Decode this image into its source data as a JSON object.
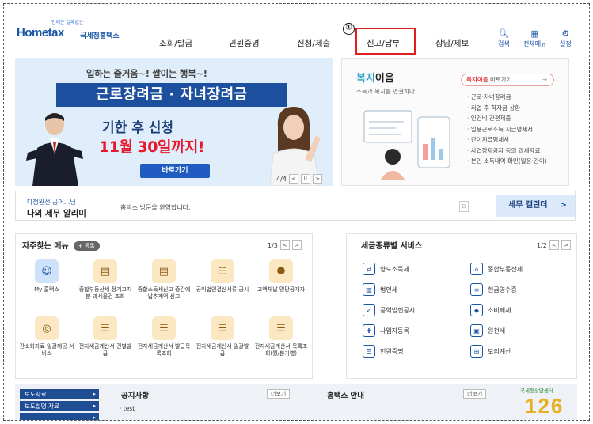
{
  "header": {
    "logo_tagline": "언제든 실패없는",
    "logo_main": "Hometax",
    "logo_sub": "국세청홈택스",
    "nav": [
      "조회/발급",
      "민원증명",
      "신청/제출",
      "신고/납부",
      "상담/제보"
    ],
    "active_nav": "신고/납부",
    "step_marker": "①",
    "utilities": [
      {
        "label": "검색",
        "icon": "search-icon"
      },
      {
        "label": "전체메뉴",
        "icon": "grid-icon"
      },
      {
        "label": "설정",
        "icon": "gear-icon"
      }
    ]
  },
  "banner": {
    "tagline": "일하는 즐거움~! 쌀이는 행복~!",
    "title": "근로장려금 · 자녀장려금",
    "line1": "기한 후 신청",
    "line2": "11월 30일까지!",
    "button": "바로가기",
    "pager": "4/4",
    "pager_prev": "<",
    "pager_pause": "II",
    "pager_next": ">"
  },
  "welfare": {
    "title_hl": "복지",
    "title_rest": "이음",
    "subtitle": "소득과 복지를 연결하다!",
    "button_hl": "복지이음",
    "button_rest": " 바로가기",
    "items": [
      "근로·자녀장려금",
      "취업 후 학자금 상환",
      "인건비 간편제출",
      "일용근로소득 지급명세서",
      "간이지급명세서",
      "사업장제공자 등의 과세자료",
      "본인 소득내역 확인(일용·간이)"
    ]
  },
  "notify": {
    "user": "다정완선 공어...님",
    "label": "나의 세무 알리미",
    "welcome": "홈택스 방문을 환영합니다.",
    "b_button": "B",
    "calendar": "세무 캘린더",
    "calendar_arrow": ">"
  },
  "favorites": {
    "title": "자주찾는 메뉴",
    "badge": "+ 등록",
    "page": "1/3",
    "prev": "<",
    "next": ">",
    "items": [
      {
        "label": "My 홈택스",
        "icon": "user-icon"
      },
      {
        "label": "종합부동산세 정기고지분 과세물건 조회",
        "icon": "calendar-icon"
      },
      {
        "label": "종합소득세신고 중간예납추계액 신고",
        "icon": "calendar-icon"
      },
      {
        "label": "공익법인결산서류 공시",
        "icon": "document-icon"
      },
      {
        "label": "고액체납 명단공개자",
        "icon": "people-icon"
      },
      {
        "label": "간소화자료 일괄제공 서비스",
        "icon": "coins-icon"
      },
      {
        "label": "전자세금계산서 건별발급",
        "icon": "invoice-icon"
      },
      {
        "label": "전자세금계산서 발급목록조회",
        "icon": "invoice-icon"
      },
      {
        "label": "전자세금계산서 일괄발급",
        "icon": "invoice-icon"
      },
      {
        "label": "전자세금계산서 목록조회(월/분기별)",
        "icon": "invoice-icon"
      }
    ]
  },
  "tax_services": {
    "title": "세금종류별 서비스",
    "page": "1/2",
    "prev": "<",
    "next": ">",
    "items": [
      {
        "label": "양도소득세",
        "icon": "transfer-icon"
      },
      {
        "label": "종합부동산세",
        "icon": "building-icon"
      },
      {
        "label": "법인세",
        "icon": "corporate-icon"
      },
      {
        "label": "현금영수증",
        "icon": "receipt-icon"
      },
      {
        "label": "공익법인공시",
        "icon": "notice-icon"
      },
      {
        "label": "소비제세",
        "icon": "diamond-icon"
      },
      {
        "label": "사업자등록",
        "icon": "register-icon"
      },
      {
        "label": "원천세",
        "icon": "tax-icon"
      },
      {
        "label": "민원증명",
        "icon": "certificate-icon"
      },
      {
        "label": "모의계산",
        "icon": "calculator-icon"
      }
    ]
  },
  "footer": {
    "side_items": [
      "보도자료",
      "보도설명 자료",
      ""
    ],
    "notice_title": "공지사항",
    "notice_more": "더보기",
    "notice_post": "· test",
    "guide_title": "홈택스 안내",
    "guide_more": "더보기",
    "promo_text": "국세청상담센터",
    "promo_number": "126"
  }
}
